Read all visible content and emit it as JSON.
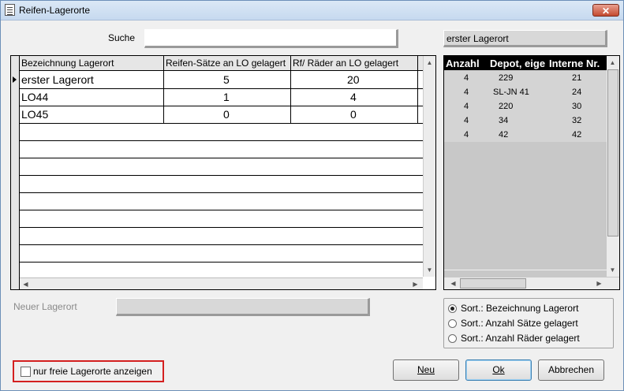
{
  "window": {
    "title": "Reifen-Lagerorte",
    "close_glyph": "✕"
  },
  "search": {
    "label": "Suche",
    "value": ""
  },
  "selected_location": {
    "value": "erster Lagerort"
  },
  "left_table": {
    "columns": [
      "Bezeichnung Lagerort",
      "Reifen-Sätze an LO gelagert",
      "Rf/ Räder an LO gelagert"
    ],
    "rows": [
      {
        "name": "erster Lagerort",
        "sets": "5",
        "wheels": "20",
        "current": true
      },
      {
        "name": "LO44",
        "sets": "1",
        "wheels": "4"
      },
      {
        "name": "LO45",
        "sets": "0",
        "wheels": "0"
      }
    ]
  },
  "right_table": {
    "columns": [
      "Anzahl",
      "Depot, eige",
      "Interne Nr."
    ],
    "rows": [
      {
        "count": "4",
        "depot": "229",
        "internal": "21"
      },
      {
        "count": "4",
        "depot": "SL-JN 41",
        "internal": "24"
      },
      {
        "count": "4",
        "depot": "220",
        "internal": "30"
      },
      {
        "count": "4",
        "depot": "34",
        "internal": "32"
      },
      {
        "count": "4",
        "depot": "42",
        "internal": "42"
      }
    ]
  },
  "new_location": {
    "label": "Neuer Lagerort",
    "value": ""
  },
  "sort_options": [
    {
      "label": "Sort.: Bezeichnung Lagerort",
      "selected": true
    },
    {
      "label": "Sort.: Anzahl Sätze gelagert",
      "selected": false
    },
    {
      "label": "Sort.: Anzahl Räder gelagert",
      "selected": false
    }
  ],
  "only_free": {
    "label": "nur freie Lagerorte anzeigen",
    "checked": false
  },
  "buttons": {
    "new": "Neu",
    "ok": "Ok",
    "cancel": "Abbrechen"
  }
}
